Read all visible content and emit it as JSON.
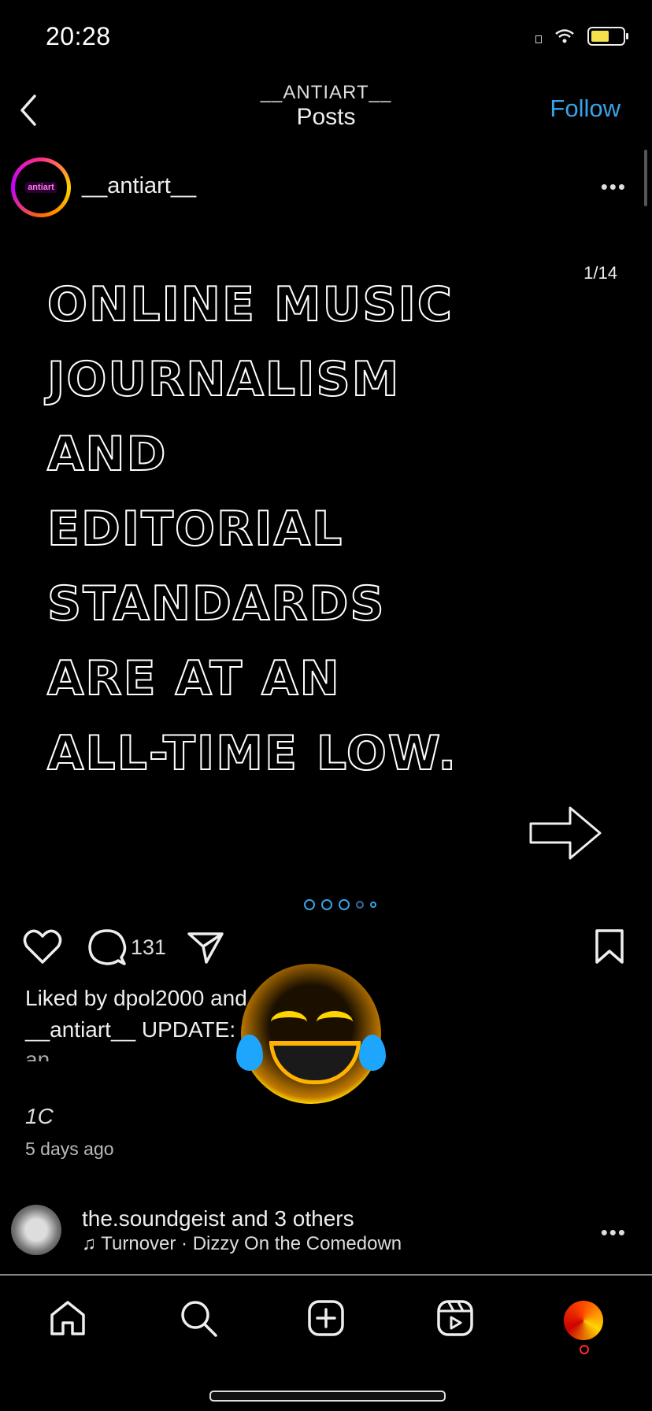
{
  "status_bar": {
    "time": "20:28"
  },
  "header": {
    "username": "__ANTIART__",
    "title": "Posts",
    "follow_label": "Follow"
  },
  "post": {
    "avatar_text": "antiart",
    "username": "__antiart__",
    "counter": "1/14",
    "image_lines": [
      "ONLINE MUSIC",
      "JOURNALISM",
      "AND",
      "EDITORIAL",
      "STANDARDS",
      "ARE AT AN",
      "ALL-TIME LOW."
    ],
    "comment_count": "131",
    "liked_by": "Liked by dpol2000 and",
    "caption": "__antiart__ UPDATE:",
    "caption_cut": "an",
    "partial_text": "1C",
    "time_ago": "5 days ago"
  },
  "next_post": {
    "username": "the.soundgeist and 3 others",
    "audio": "Turnover · Dizzy On the Comedown"
  },
  "colors": {
    "accent": "#39a3e6",
    "background": "#000000"
  }
}
